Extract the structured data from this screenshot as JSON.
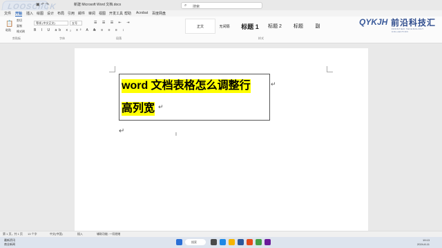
{
  "titlebar": {
    "title": "新建 Microsoft Word 文档.docx",
    "search_placeholder": "搜索",
    "watermark": "LOOSCIICK"
  },
  "menu": [
    "文件",
    "开始",
    "插入",
    "绘图",
    "设计",
    "布局",
    "引用",
    "邮件",
    "审阅",
    "视图",
    "开发工具",
    "帮助",
    "Acrobat",
    "百度网盘"
  ],
  "ribbon": {
    "paste_label": "粘贴",
    "cut_label": "剪切",
    "copy_label": "复制",
    "format_painter_label": "格式刷",
    "font_name": "等线 (中文正文)",
    "font_size": "五号",
    "styles": [
      "正文",
      "无间隔",
      "标题 1",
      "标题 2",
      "标题",
      "副"
    ],
    "groups": [
      "剪贴板",
      "字体",
      "段落",
      "样式"
    ]
  },
  "logo": {
    "mark": "QYKJH",
    "name": "前沿科技汇",
    "tagline": "FRONTIER TECHNOLOGY COLLECTION"
  },
  "document": {
    "line1": "word  文档表格怎么调整行",
    "line2": "高列宽"
  },
  "status": {
    "page": "第 1 页，共 1 页",
    "words": "13 个字",
    "lang": "中文(中国)",
    "insert": "插入",
    "accessibility": "辅助功能: 一切就绪"
  },
  "taskbar": {
    "weather_title": "最新资讯",
    "weather_sub": "商业新闻",
    "search": "搜索",
    "time": "19:13",
    "date": "2024-8-11"
  }
}
